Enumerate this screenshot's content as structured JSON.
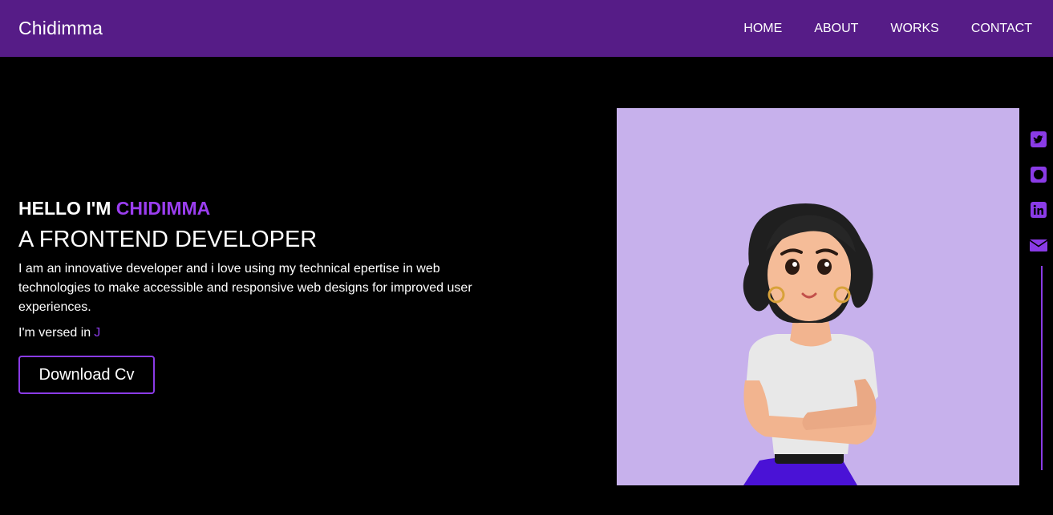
{
  "navbar": {
    "brand": "Chidimma",
    "links": [
      "HOME",
      "ABOUT",
      "WORKS",
      "CONTACT"
    ]
  },
  "hero": {
    "greeting_prefix": "HELLO I'M ",
    "greeting_name": "CHIDIMMA",
    "role": "A FRONTEND DEVELOPER",
    "intro": "I am an innovative developer and i love using my technical epertise in web technologies to make accessible and responsive web designs for improved user experiences.",
    "versed_label": "I'm versed in",
    "versed_typed": "J",
    "cv_button": "Download Cv"
  },
  "social": [
    "twitter-icon",
    "github-icon",
    "linkedin-icon",
    "mail-icon"
  ],
  "colors": {
    "navbar_bg": "#561c87",
    "accent": "#9b3ef0",
    "portrait_bg": "#c7b1ec",
    "page_bg": "#000000"
  }
}
